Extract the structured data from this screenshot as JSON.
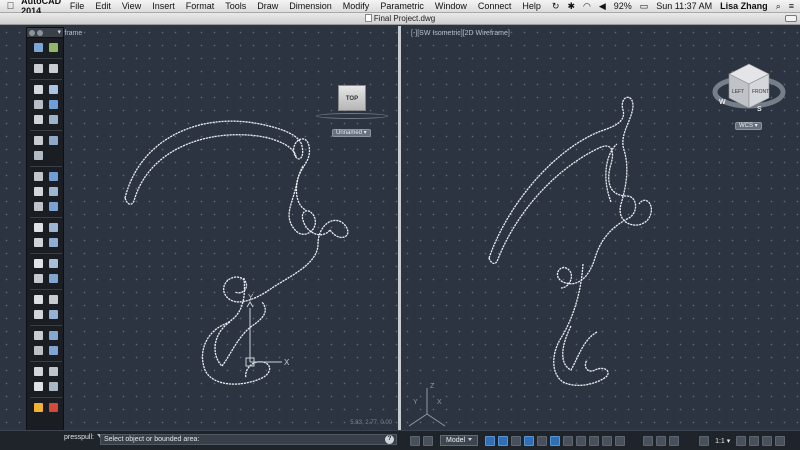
{
  "menubar": {
    "app": "AutoCAD 2014",
    "items": [
      "File",
      "Edit",
      "View",
      "Insert",
      "Format",
      "Tools",
      "Draw",
      "Dimension",
      "Modify",
      "Parametric",
      "Window",
      "Connect",
      "Help"
    ],
    "battery": "92%",
    "clock": "Sun 11:37 AM",
    "user": "Lisa Zhang",
    "icons": [
      "apple-icon",
      "sync-icon",
      "bluetooth-icon",
      "wifi-icon",
      "volume-icon",
      "battery-icon",
      "spotlight-icon",
      "list-icon"
    ]
  },
  "window": {
    "title": "Final Project.dwg"
  },
  "viewports": {
    "left": {
      "label": "Wireframe",
      "view_cube": "TOP",
      "ucs_menu": "Unnamed",
      "coordinates": "5.83, 2.77, 0.00"
    },
    "right": {
      "label": "[-][SW Isometric][2D Wireframe]",
      "cube_faces": [
        "LEFT",
        "FRONT"
      ],
      "compass": [
        "W",
        "S"
      ],
      "ucs_menu": "WCS"
    }
  },
  "command": {
    "prefix": "presspull:",
    "prompt": "Select object or bounded area:",
    "help": "?"
  },
  "status": {
    "space": "Model",
    "scale": "1:1"
  },
  "colors": {
    "viewport_bg": "#2b3440",
    "curve": "#e9edf2",
    "ucs": "#c9cfd6",
    "highlight": "#2f6fb7"
  }
}
